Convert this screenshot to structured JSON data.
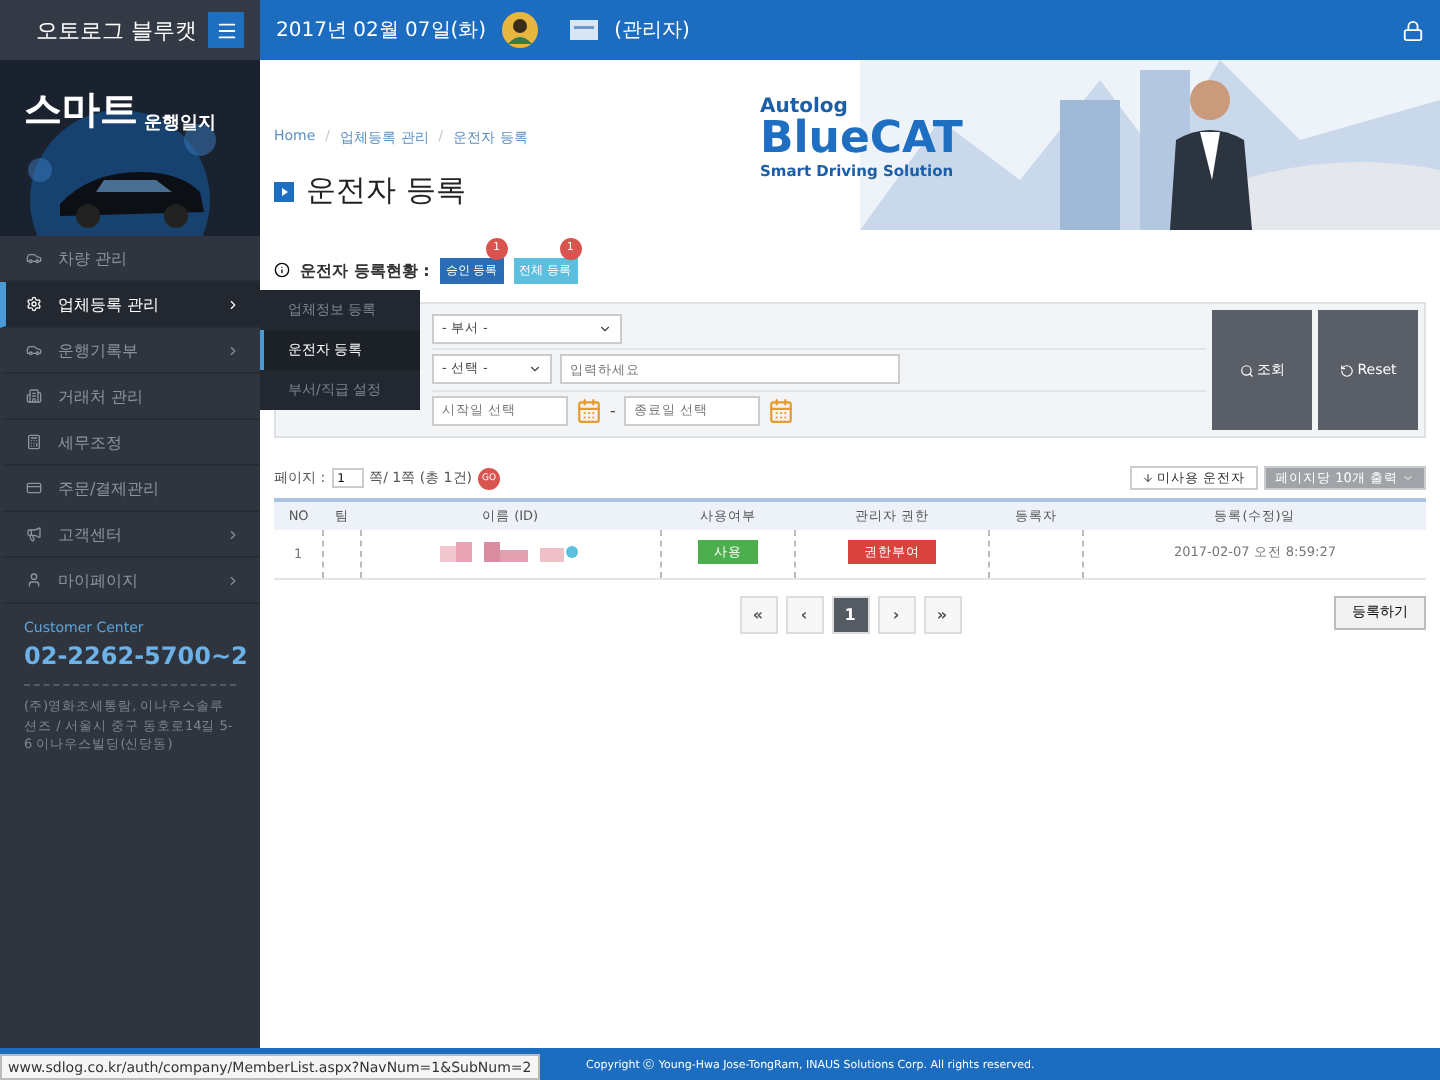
{
  "header": {
    "brand": "오토로그 블루캣",
    "date": "2017년 02월 07일(화)",
    "user": "(관리자)"
  },
  "sidebar": {
    "promo": {
      "kind": "picture",
      "title": "스마트",
      "subtitle": "운행일지"
    },
    "items": [
      {
        "label": "차량 관리",
        "selected": false,
        "has_children": false
      },
      {
        "label": "업체등록 관리",
        "selected": true,
        "has_children": true
      },
      {
        "label": "운행기록부",
        "selected": false,
        "has_children": true
      },
      {
        "label": "거래처 관리",
        "selected": false,
        "has_children": false
      },
      {
        "label": "세무조정",
        "selected": false,
        "has_children": false
      },
      {
        "label": "주문/결제관리",
        "selected": false,
        "has_children": false
      },
      {
        "label": "고객센터",
        "selected": false,
        "has_children": true
      },
      {
        "label": "마이페이지",
        "selected": false,
        "has_children": true
      }
    ],
    "submenu": [
      {
        "label": "업체정보 등록",
        "selected": false
      },
      {
        "label": "운전자 등록",
        "selected": true
      },
      {
        "label": "부서/직급 설정",
        "selected": false
      }
    ],
    "customer_center": {
      "label": "Customer Center",
      "phone": "02-2262-5700~2",
      "address": "(주)영화조세통람, 이나우스솔루션즈 / 서울시 중구 동호로14길 5-6 이나우스빌딩(신당동)"
    }
  },
  "banner": {
    "kind": "picture",
    "brand_top": "Autolog",
    "brand": "BlueCAT",
    "tagline": "Smart Driving Solution"
  },
  "breadcrumb": [
    {
      "kind": "link",
      "text": "Home"
    },
    {
      "kind": "separator",
      "text": "/"
    },
    {
      "kind": "link",
      "text": "업체등록 관리"
    },
    {
      "kind": "separator",
      "text": "/"
    },
    {
      "kind": "link",
      "text": "운전자 등록"
    }
  ],
  "page_title": "운전자 등록",
  "status": {
    "label": "운전자 등록현황 :",
    "badges": [
      {
        "label": "승인 등록",
        "count": "1",
        "color": "#2a6db5"
      },
      {
        "label": "전체 등록",
        "count": "1",
        "color": "#5bc0de"
      }
    ]
  },
  "search": {
    "department": "- 부서 -",
    "field_select": "- 선택 -",
    "keyword_placeholder": "입력하세요",
    "start_placeholder": "시작일 선택",
    "separator": "-",
    "end_placeholder": "종료일 선택",
    "search_button": "조회",
    "reset_button": "Reset"
  },
  "paging_info": {
    "label": "페이지 :",
    "page": "1",
    "summary": "쪽/ 1쪽 (총 1건)",
    "go": "GO"
  },
  "actions": {
    "inactive_button": "미사용 운전자",
    "per_page": "페이지당 10개 출력"
  },
  "table": {
    "columns": [
      "NO",
      "팀",
      "이름 (ID)",
      "사용여부",
      "관리자 권한",
      "등록자",
      "등록(수정)일"
    ],
    "rows": [
      [
        {
          "kind": "text",
          "text": "1"
        },
        {
          "kind": "blank"
        },
        {
          "kind": "masked"
        },
        {
          "kind": "tag",
          "text": "사용",
          "color": "#4cae4c"
        },
        {
          "kind": "tag",
          "text": "권한부여",
          "color": "#d9423f"
        },
        {
          "kind": "blank"
        },
        {
          "kind": "text",
          "text": "2017-02-07 오전 8:59:27"
        }
      ]
    ]
  },
  "pagination": [
    {
      "label": "«",
      "selected": false
    },
    {
      "label": "‹",
      "selected": false
    },
    {
      "label": "1",
      "selected": true
    },
    {
      "label": "›",
      "selected": false
    },
    {
      "label": "»",
      "selected": false
    }
  ],
  "register_button": "등록하기",
  "footer": "Copyright ⓒ Young-Hwa Jose-TongRam, INAUS Solutions Corp. All rights reserved.",
  "status_url": "www.sdlog.co.kr/auth/company/MemberList.aspx?NavNum=1&SubNum=2"
}
